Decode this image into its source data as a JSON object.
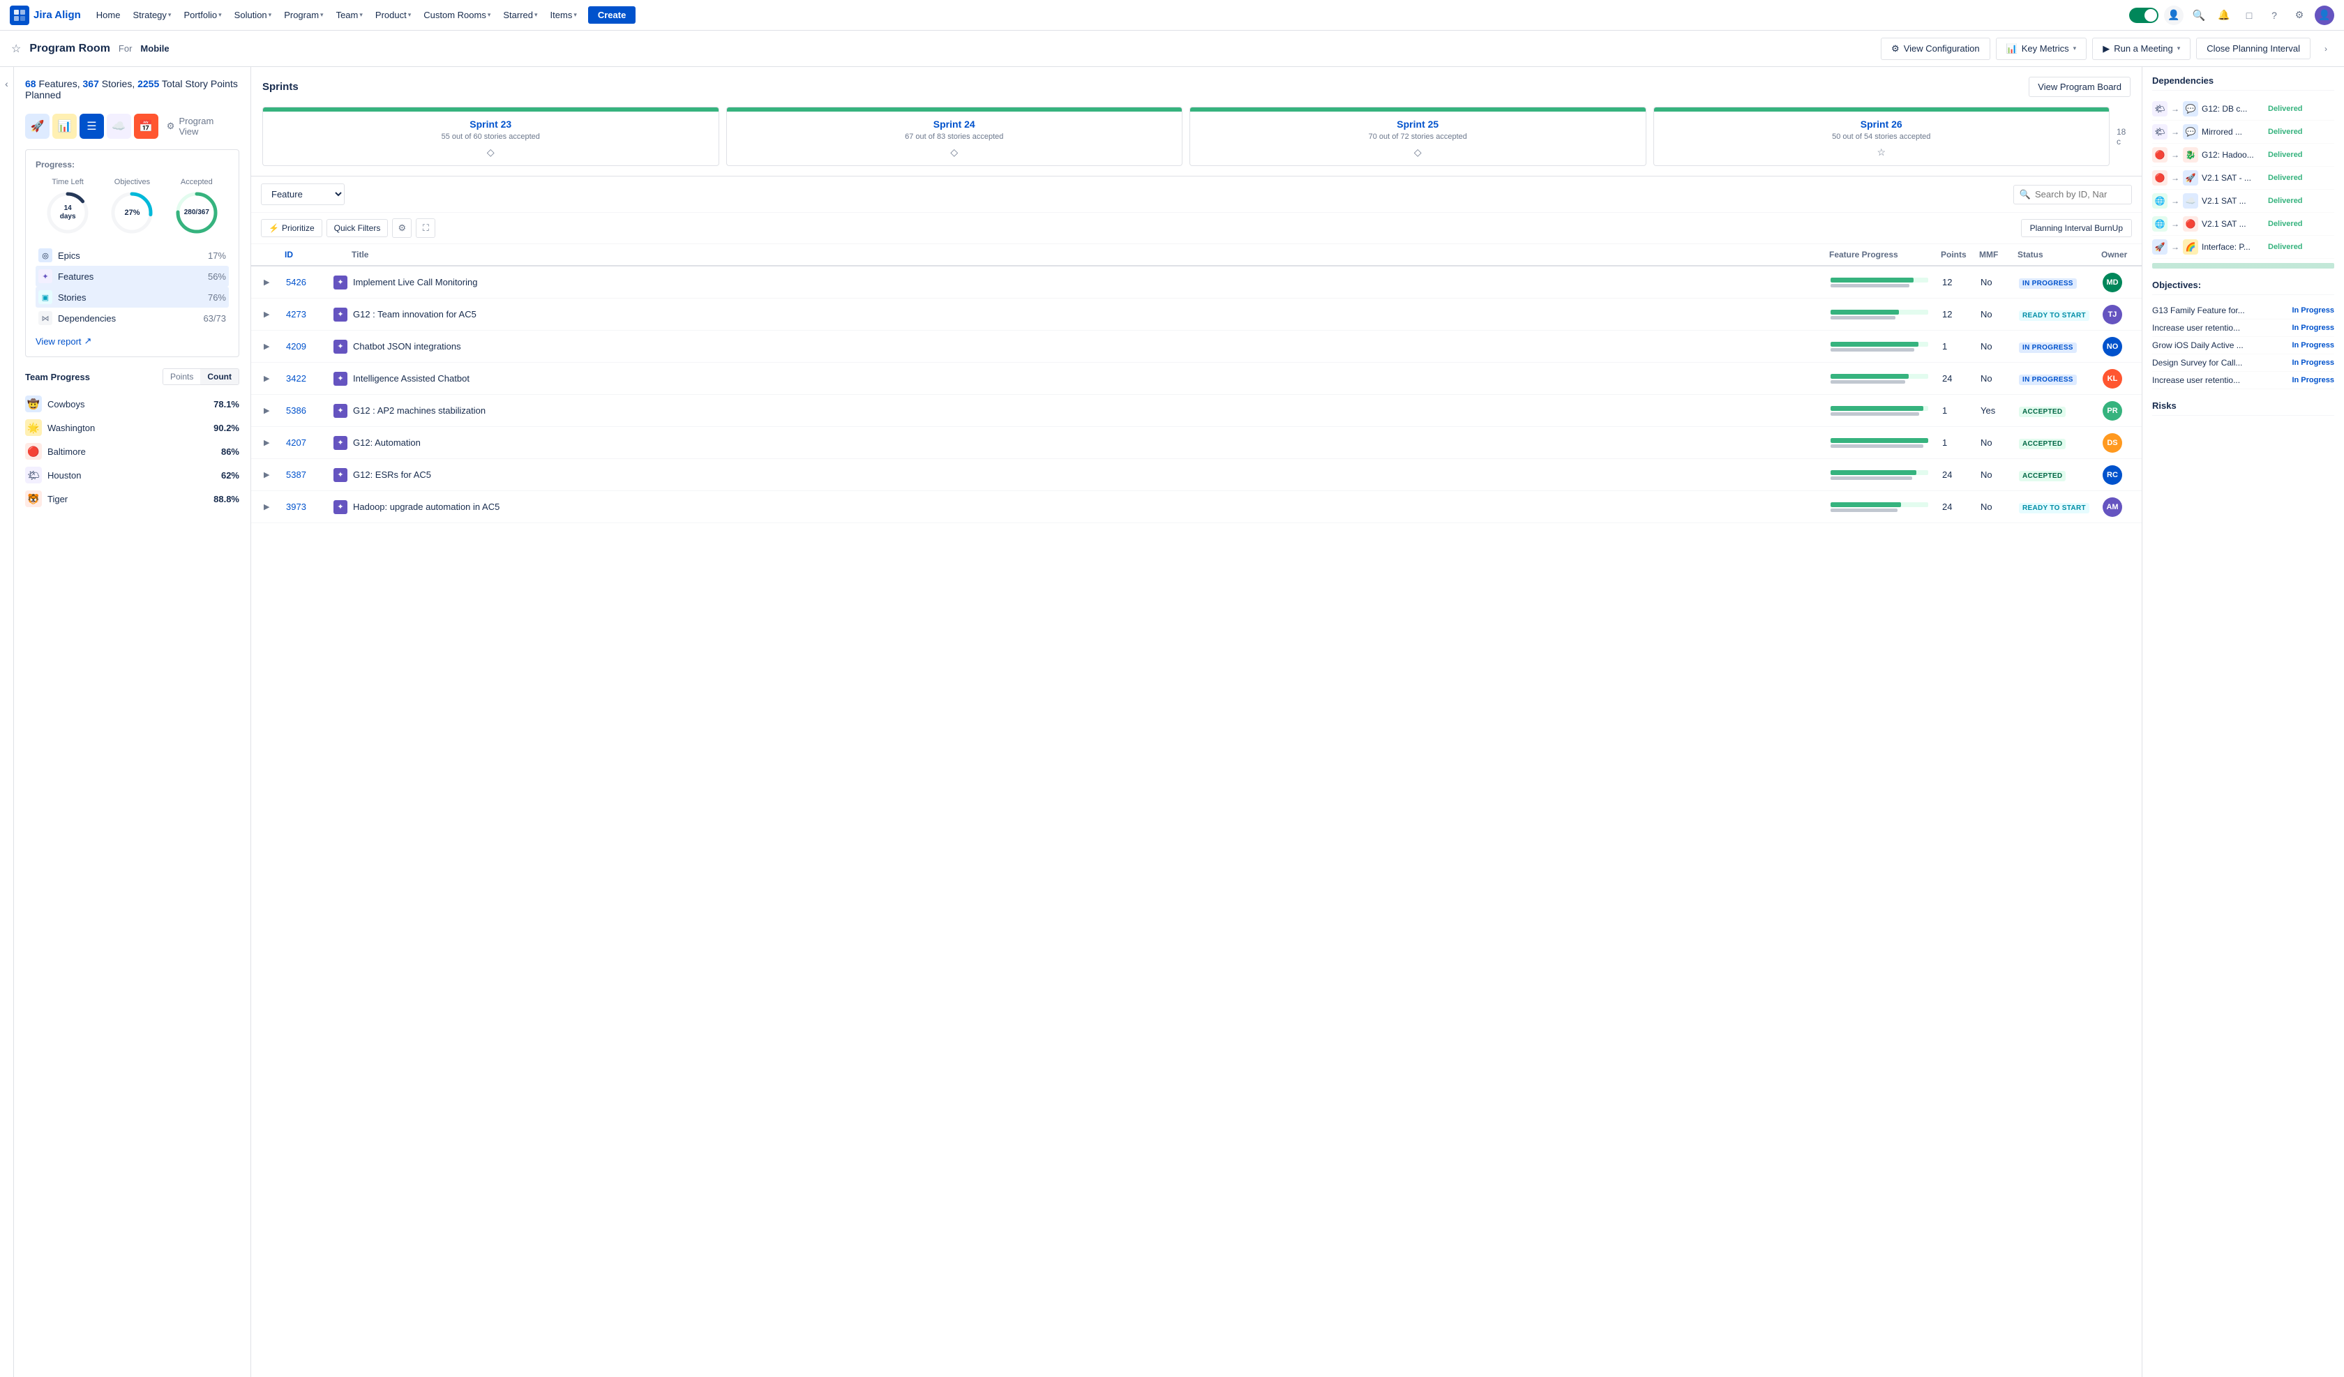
{
  "app": {
    "logo_text": "Jira Align",
    "logo_abbr": "JA"
  },
  "nav": {
    "items": [
      {
        "label": "Home",
        "has_dropdown": false
      },
      {
        "label": "Strategy",
        "has_dropdown": true
      },
      {
        "label": "Portfolio",
        "has_dropdown": true
      },
      {
        "label": "Solution",
        "has_dropdown": true
      },
      {
        "label": "Program",
        "has_dropdown": true
      },
      {
        "label": "Team",
        "has_dropdown": true
      },
      {
        "label": "Product",
        "has_dropdown": true
      },
      {
        "label": "Custom Rooms",
        "has_dropdown": true
      },
      {
        "label": "Starred",
        "has_dropdown": true
      },
      {
        "label": "Items",
        "has_dropdown": true
      }
    ],
    "create_label": "Create"
  },
  "subheader": {
    "title": "Program Room",
    "for_label": "For",
    "mobile_label": "Mobile",
    "buttons": [
      {
        "label": "View Configuration",
        "icon": "gear"
      },
      {
        "label": "Key Metrics",
        "icon": "chart",
        "has_dropdown": true
      },
      {
        "label": "Run a Meeting",
        "icon": "meeting",
        "has_dropdown": true
      },
      {
        "label": "Close Planning Interval",
        "icon": "close"
      }
    ]
  },
  "stats": {
    "features_count": "68",
    "stories_count": "367",
    "story_points": "2255",
    "features_label": "Features,",
    "stories_label": "Stories,",
    "total_label": "Total Story Points Planned"
  },
  "view_icons": [
    {
      "name": "rocket-icon",
      "emoji": "🚀",
      "color": "#0065ff",
      "bg": "#deebff"
    },
    {
      "name": "chart-icon",
      "emoji": "📊",
      "color": "#ff991f",
      "bg": "#fff0b3"
    },
    {
      "name": "list-icon",
      "emoji": "☰",
      "color": "#fff",
      "bg": "#0052cc"
    },
    {
      "name": "cloud-icon",
      "emoji": "☁️",
      "color": "#8777d9",
      "bg": "#f3f0ff"
    },
    {
      "name": "calendar-icon",
      "emoji": "📅",
      "color": "#fff",
      "bg": "#ff5630"
    }
  ],
  "program_view_label": "Program View",
  "progress": {
    "title": "Progress:",
    "time_left_label": "Time Left",
    "objectives_label": "Objectives",
    "accepted_label": "Accepted",
    "time_left_value": "14 days",
    "objectives_pct": 27,
    "objectives_value": "27%",
    "accepted_value": "280/367",
    "accepted_pct": 76,
    "items": [
      {
        "icon": "◎",
        "icon_color": "#0052cc",
        "icon_bg": "#deebff",
        "label": "Epics",
        "pct": "17%"
      },
      {
        "icon": "✦",
        "icon_color": "#6554c0",
        "icon_bg": "#f3f0ff",
        "label": "Features",
        "pct": "56%"
      },
      {
        "icon": "▣",
        "icon_color": "#00a3bf",
        "icon_bg": "#e6fcff",
        "label": "Stories",
        "pct": "76%"
      },
      {
        "icon": "⋈",
        "icon_color": "#6b778c",
        "icon_bg": "#f4f5f7",
        "label": "Dependencies",
        "pct": "63/73"
      }
    ],
    "view_report_label": "View report"
  },
  "team_progress": {
    "title": "Team Progress",
    "tabs": [
      "Points",
      "Count"
    ],
    "active_tab": "Points",
    "teams": [
      {
        "name": "Cowboys",
        "icon": "🤠",
        "icon_bg": "#deebff",
        "pct": "78.1%",
        "pct_num": 78.1
      },
      {
        "name": "Washington",
        "icon": "🌟",
        "icon_bg": "#fff0b3",
        "pct": "90.2%",
        "pct_num": 90.2
      },
      {
        "name": "Baltimore",
        "icon": "🔴",
        "icon_bg": "#ffebe6",
        "pct": "86%",
        "pct_num": 86
      },
      {
        "name": "Houston",
        "icon": "🌤",
        "icon_bg": "#f3f0ff",
        "pct": "62%",
        "pct_num": 62
      },
      {
        "name": "Tiger",
        "icon": "🐯",
        "icon_bg": "#ffebe6",
        "pct": "88.8%",
        "pct_num": 88.8
      }
    ]
  },
  "sprints": {
    "title": "Sprints",
    "view_board_label": "View Program Board",
    "cards": [
      {
        "name": "Sprint 23",
        "accepted": "55 out of 60 stories accepted",
        "pct": 92
      },
      {
        "name": "Sprint 24",
        "accepted": "67 out of 83 stories accepted",
        "pct": 81
      },
      {
        "name": "Sprint 25",
        "accepted": "70 out of 72 stories accepted",
        "pct": 97
      },
      {
        "name": "Sprint 26",
        "accepted": "50 out of 54 stories accepted",
        "pct": 93
      }
    ]
  },
  "features": {
    "filter_label": "Feature",
    "search_placeholder": "Search by ID, Nar",
    "toolbar_btns": [
      "Prioritize",
      "Quick Filters",
      "Planning Interval BurnUp"
    ],
    "columns": [
      "ID",
      "Title",
      "Feature Progress",
      "Points",
      "MMF",
      "Status",
      "Owner"
    ],
    "rows": [
      {
        "id": "5426",
        "icon": "✦",
        "icon_bg": "#6554c0",
        "title": "Implement Live Call Monitoring",
        "progress_pct": 85,
        "points": "12",
        "mmf": "No",
        "status": "IN PROGRESS",
        "status_type": "inprogress",
        "owner_color": "#00875a",
        "owner_initials": "MD"
      },
      {
        "id": "4273",
        "icon": "✦",
        "icon_bg": "#6554c0",
        "title": "G12 : Team innovation for AC5",
        "progress_pct": 70,
        "points": "12",
        "mmf": "No",
        "status": "READY TO START",
        "status_type": "ready",
        "owner_color": "#6554c0",
        "owner_initials": "TJ"
      },
      {
        "id": "4209",
        "icon": "✦",
        "icon_bg": "#6554c0",
        "title": "Chatbot JSON integrations",
        "progress_pct": 90,
        "points": "1",
        "mmf": "No",
        "status": "IN PROGRESS",
        "status_type": "inprogress",
        "owner_color": "#0052cc",
        "owner_initials": "NO"
      },
      {
        "id": "3422",
        "icon": "✦",
        "icon_bg": "#6554c0",
        "title": "Intelligence Assisted Chatbot",
        "progress_pct": 80,
        "points": "24",
        "mmf": "No",
        "status": "IN PROGRESS",
        "status_type": "inprogress",
        "owner_color": "#ff5630",
        "owner_initials": "KL"
      },
      {
        "id": "5386",
        "icon": "✦",
        "icon_bg": "#6554c0",
        "title": "G12 : AP2 machines stabilization",
        "progress_pct": 95,
        "points": "1",
        "mmf": "Yes",
        "status": "ACCEPTED",
        "status_type": "accepted",
        "owner_color": "#36b37e",
        "owner_initials": "PR"
      },
      {
        "id": "4207",
        "icon": "✦",
        "icon_bg": "#6554c0",
        "title": "G12: Automation",
        "progress_pct": 100,
        "points": "1",
        "mmf": "No",
        "status": "ACCEPTED",
        "status_type": "accepted",
        "owner_color": "#ff991f",
        "owner_initials": "DS"
      },
      {
        "id": "5387",
        "icon": "✦",
        "icon_bg": "#6554c0",
        "title": "G12: ESRs for AC5",
        "progress_pct": 88,
        "points": "24",
        "mmf": "No",
        "status": "ACCEPTED",
        "status_type": "accepted",
        "owner_color": "#0052cc",
        "owner_initials": "RC"
      },
      {
        "id": "3973",
        "icon": "✦",
        "icon_bg": "#6554c0",
        "title": "Hadoop: upgrade automation in AC5",
        "progress_pct": 72,
        "points": "24",
        "mmf": "No",
        "status": "READY TO START",
        "status_type": "ready",
        "owner_color": "#6554c0",
        "owner_initials": "AM"
      }
    ]
  },
  "dependencies_section": {
    "title": "Dependencies",
    "items": [
      {
        "from_icon": "🌤",
        "from_bg": "#f3f0ff",
        "to_icon": "💬",
        "to_bg": "#deebff",
        "text": "G12: DB c...",
        "status": "Delivered"
      },
      {
        "from_icon": "🌤",
        "from_bg": "#f3f0ff",
        "to_icon": "💬",
        "to_bg": "#deebff",
        "text": "Mirrored ...",
        "status": "Delivered"
      },
      {
        "from_icon": "🔴",
        "from_bg": "#ffebe6",
        "to_icon": "🐉",
        "to_bg": "#ffebe6",
        "text": "G12: Hadoo...",
        "status": "Delivered"
      },
      {
        "from_icon": "🔴",
        "from_bg": "#ffebe6",
        "to_icon": "🚀",
        "to_bg": "#deebff",
        "text": "V2.1 SAT - ...",
        "status": "Delivered"
      },
      {
        "from_icon": "🌐",
        "from_bg": "#e3fcef",
        "to_icon": "☁️",
        "to_bg": "#deebff",
        "text": "V2.1 SAT ...",
        "status": "Delivered"
      },
      {
        "from_icon": "🌐",
        "from_bg": "#e3fcef",
        "to_icon": "🔴",
        "to_bg": "#ffebe6",
        "text": "V2.1 SAT ...",
        "status": "Delivered"
      },
      {
        "from_icon": "🚀",
        "from_bg": "#deebff",
        "to_icon": "🌈",
        "to_bg": "#fff0b3",
        "text": "Interface: P...",
        "status": "Delivered"
      }
    ]
  },
  "objectives_section": {
    "title": "Objectives:",
    "items": [
      {
        "text": "G13 Family Feature for...",
        "status": "In Progress"
      },
      {
        "text": "Increase user retentio...",
        "status": "In Progress"
      },
      {
        "text": "Grow iOS Daily Active ...",
        "status": "In Progress"
      },
      {
        "text": "Design Survey for Call...",
        "status": "In Progress"
      },
      {
        "text": "Increase user retentio...",
        "status": "In Progress"
      }
    ]
  },
  "risks_section_title": "Risks"
}
